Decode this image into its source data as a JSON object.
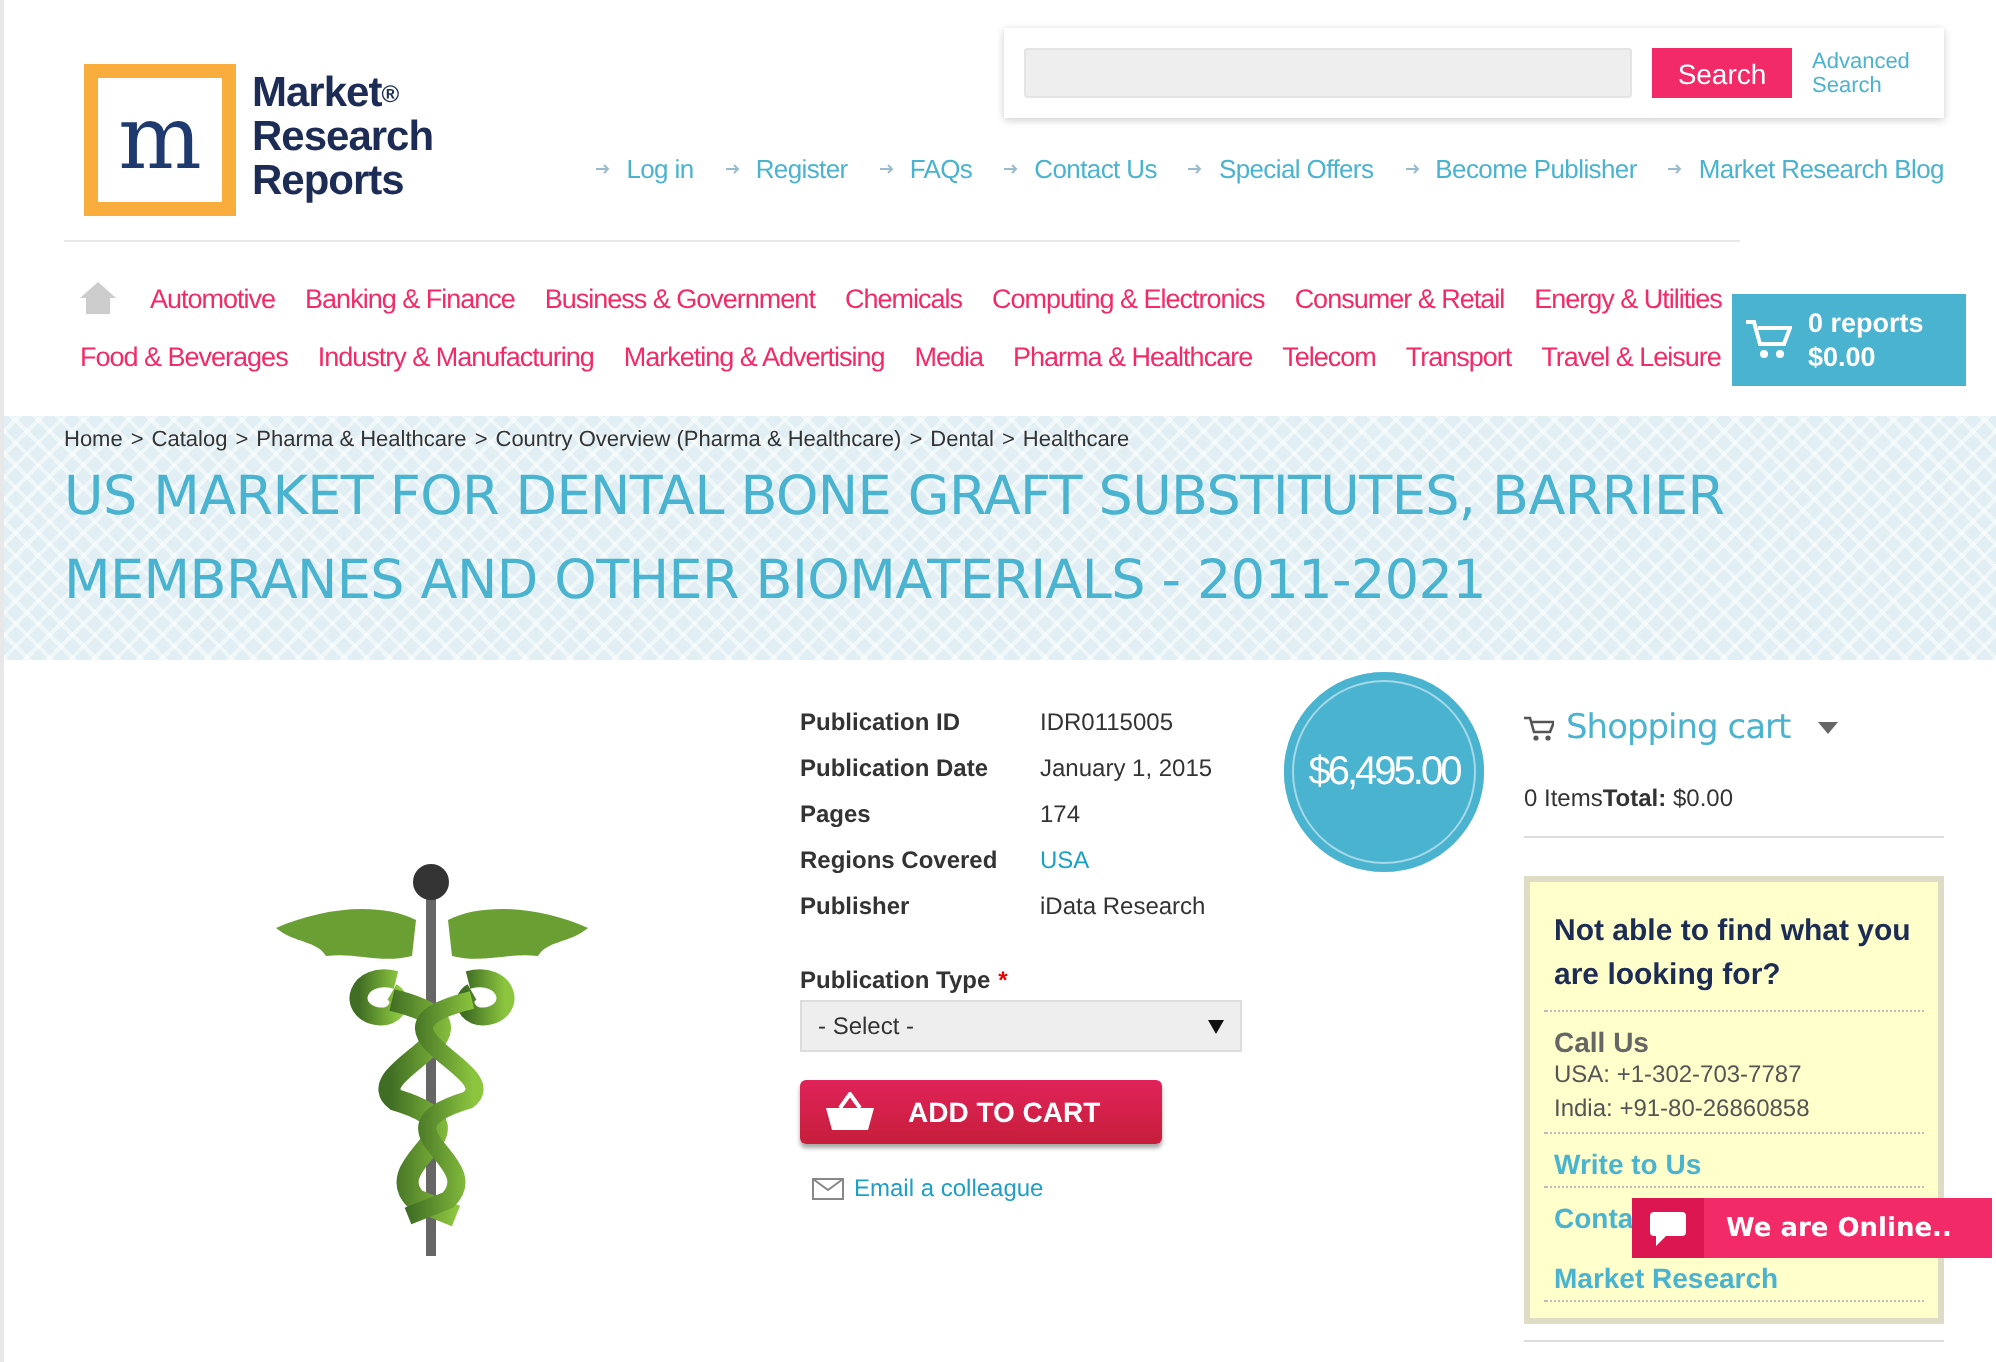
{
  "logo": {
    "mark": "m",
    "lines": [
      "Market",
      "Research",
      "Reports"
    ],
    "registered": "®"
  },
  "search": {
    "button": "Search",
    "advanced": "Advanced Search"
  },
  "top_links": [
    "Log in",
    "Register",
    "FAQs",
    "Contact Us",
    "Special Offers",
    "Become Publisher",
    "Market Research Blog"
  ],
  "categories": [
    [
      "Automotive",
      "Banking & Finance",
      "Business & Government",
      "Chemicals",
      "Computing & Electronics",
      "Consumer & Retail",
      "Energy & Utilities"
    ],
    [
      "Food & Beverages",
      "Industry & Manufacturing",
      "Marketing & Advertising",
      "Media",
      "Pharma & Healthcare",
      "Telecom",
      "Transport",
      "Travel & Leisure"
    ]
  ],
  "cart_badge": {
    "count": "0 reports",
    "total": "$0.00"
  },
  "breadcrumb": [
    "Home",
    "Catalog",
    "Pharma & Healthcare",
    "Country Overview (Pharma & Healthcare)",
    "Dental",
    "Healthcare"
  ],
  "breadcrumb_separator": ">",
  "title": "US MARKET FOR DENTAL BONE GRAFT SUBSTITUTES, BARRIER MEMBRANES AND OTHER BIOMATERIALS - 2011-2021",
  "details": [
    {
      "label": "Publication ID",
      "value": "IDR0115005",
      "kind": "text"
    },
    {
      "label": "Publication Date",
      "value": "January 1, 2015",
      "kind": "text"
    },
    {
      "label": "Pages",
      "value": "174",
      "kind": "text"
    },
    {
      "label": "Regions Covered",
      "value": "USA",
      "kind": "link"
    },
    {
      "label": "Publisher",
      "value": "iData Research",
      "kind": "text"
    }
  ],
  "price": "$6,495.00",
  "publication_type": {
    "label": "Publication Type",
    "required": "*",
    "value": "- Select -"
  },
  "add_to_cart": "ADD TO CART",
  "email_link": "Email a colleague",
  "shopping_cart": {
    "title": "Shopping cart",
    "summary": "0 Items**Total:** $0.00"
  },
  "help_box": {
    "heading": "Not able to find what you are looking for?",
    "call_title": "Call Us",
    "phones": [
      "USA: +1-302-703-7787",
      "India: +91-80-26860858"
    ],
    "write": "Write to Us",
    "contact_lines": [
      "Conta",
      "Market Research"
    ]
  },
  "chat": {
    "label": "We are Online.."
  }
}
